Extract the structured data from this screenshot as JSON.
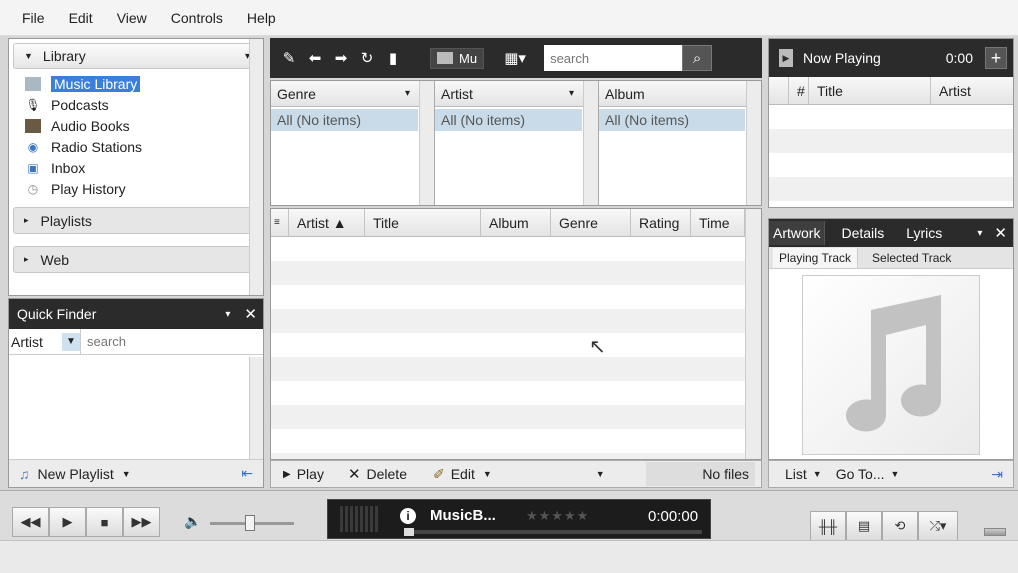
{
  "menu": [
    "File",
    "Edit",
    "View",
    "Controls",
    "Help"
  ],
  "library": {
    "header": "Library",
    "items": [
      {
        "label": "Music Library",
        "icon": "music-library-icon",
        "selected": true
      },
      {
        "label": "Podcasts",
        "icon": "podcast-icon"
      },
      {
        "label": "Audio Books",
        "icon": "audio-book-icon"
      },
      {
        "label": "Radio Stations",
        "icon": "radio-icon"
      },
      {
        "label": "Inbox",
        "icon": "inbox-icon"
      },
      {
        "label": "Play History",
        "icon": "history-icon"
      }
    ],
    "groups": [
      "Playlists",
      "Web"
    ]
  },
  "quick_finder": {
    "title": "Quick Finder",
    "field": "Artist",
    "search_placeholder": "search",
    "new_playlist": "New Playlist"
  },
  "toolbar": {
    "mu_label": "Mu",
    "search_placeholder": "search"
  },
  "filters": [
    {
      "header": "Genre",
      "item": "All  (No items)"
    },
    {
      "header": "Artist",
      "item": "All  (No items)"
    },
    {
      "header": "Album",
      "item": "All  (No items)"
    }
  ],
  "tracklist": {
    "columns": [
      "Artist ▲",
      "Title",
      "Album",
      "Genre",
      "Rating",
      "Time"
    ],
    "footer": {
      "play": "Play",
      "delete": "Delete",
      "edit": "Edit",
      "status": "No files"
    }
  },
  "now_playing": {
    "title": "Now Playing",
    "time": "0:00",
    "columns": [
      "#",
      "Title",
      "Artist"
    ]
  },
  "artwork_panel": {
    "tabs": [
      "Artwork",
      "Details",
      "Lyrics"
    ],
    "subtabs": [
      "Playing Track",
      "Selected Track"
    ],
    "footer": {
      "list": "List",
      "goto": "Go To..."
    }
  },
  "player": {
    "track": "MusicB...",
    "time": "0:00:00",
    "volume": 0.5
  },
  "colors": {
    "dark": "#2b2b2b",
    "selected": "#c9dbe9"
  }
}
